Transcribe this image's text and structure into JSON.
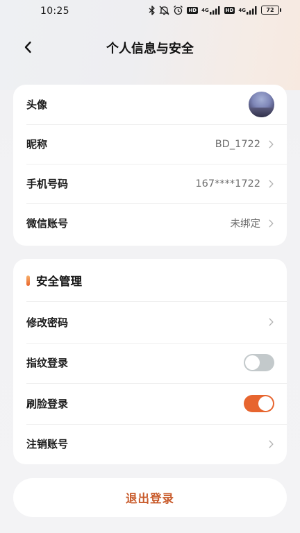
{
  "status_bar": {
    "time": "10:25",
    "hd_label": "HD",
    "network_label": "4G",
    "battery": "72",
    "icons": [
      "bluetooth-icon",
      "mute-icon",
      "alarm-icon",
      "hd-icon",
      "signal-icon",
      "hd-icon",
      "signal-icon",
      "battery-icon"
    ]
  },
  "header": {
    "title": "个人信息与安全",
    "back_icon": "chevron-left-icon"
  },
  "profile": {
    "rows": [
      {
        "label": "头像",
        "value": ""
      },
      {
        "label": "昵称",
        "value": "BD_1722"
      },
      {
        "label": "手机号码",
        "value": "167****1722"
      },
      {
        "label": "微信账号",
        "value": "未绑定"
      }
    ]
  },
  "security": {
    "title": "安全管理",
    "rows": [
      {
        "label": "修改密码",
        "control": "chevron"
      },
      {
        "label": "指纹登录",
        "control": "toggle",
        "checked": false
      },
      {
        "label": "刷脸登录",
        "control": "toggle",
        "checked": true
      },
      {
        "label": "注销账号",
        "control": "chevron"
      }
    ]
  },
  "logout": {
    "label": "退出登录"
  },
  "colors": {
    "accent": "#e7652f",
    "logout_text": "#c85a2a",
    "toggle_off": "#c3c9cb"
  }
}
